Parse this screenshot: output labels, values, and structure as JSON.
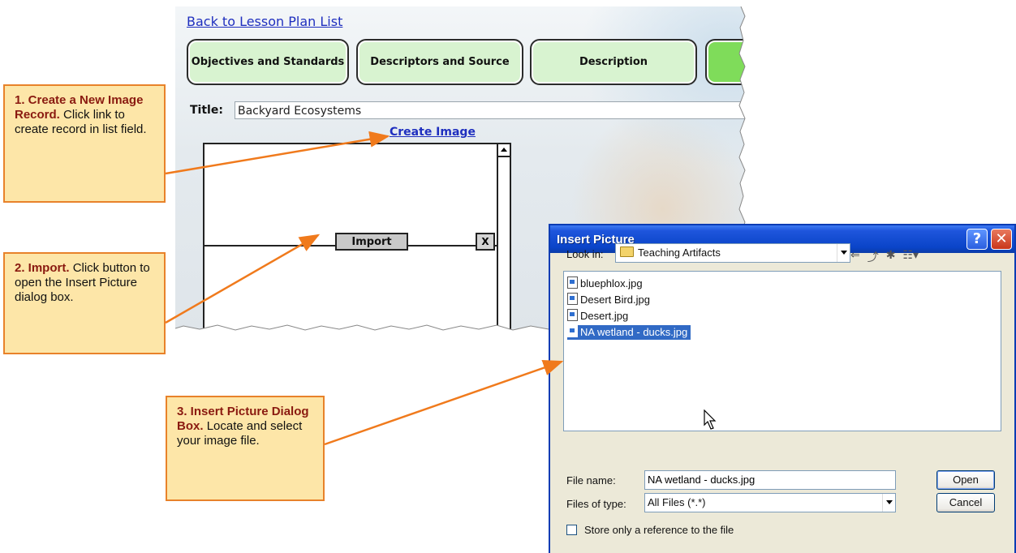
{
  "app": {
    "back_link": "Back to Lesson Plan List",
    "tabs": [
      {
        "label": "Objectives and Standards"
      },
      {
        "label": "Descriptors and Source"
      },
      {
        "label": "Description"
      },
      {
        "label": ""
      }
    ],
    "title_label": "Title:",
    "title_value": "Backyard Ecosystems",
    "create_link": "Create Image",
    "import_button": "Import",
    "delete_button": "X"
  },
  "callouts": [
    {
      "heading": "1. Create a New Image Record.",
      "body": "Click link to create record in list field."
    },
    {
      "heading": "2. Import.",
      "body": "Click button to open the Insert Picture dialog box."
    },
    {
      "heading": "3. Insert Picture Dialog Box.",
      "body": "Locate and select your image file."
    }
  ],
  "dialog": {
    "title": "Insert Picture",
    "help_button": "?",
    "close_button": "✕",
    "look_in_label": "Look in:",
    "look_in_value": "Teaching Artifacts",
    "files": [
      "bluephlox.jpg",
      "Desert Bird.jpg",
      "Desert.jpg",
      "NA wetland - ducks.jpg"
    ],
    "selected_file_index": 3,
    "file_name_label": "File name:",
    "file_name_value": "NA wetland - ducks.jpg",
    "files_of_type_label": "Files of type:",
    "files_of_type_value": "All Files (*.*)",
    "open_button": "Open",
    "cancel_button": "Cancel",
    "reference_checkbox_label": "Store only a reference to the file",
    "reference_checkbox_checked": false
  },
  "colors": {
    "callout_fill": "#fde6a8",
    "callout_border": "#e8822a",
    "callout_heading": "#8a1a10",
    "arrow": "#f07a1c",
    "tab_fill": "#d8f3d0",
    "link": "#1f2fbf",
    "selection": "#316ac5"
  }
}
